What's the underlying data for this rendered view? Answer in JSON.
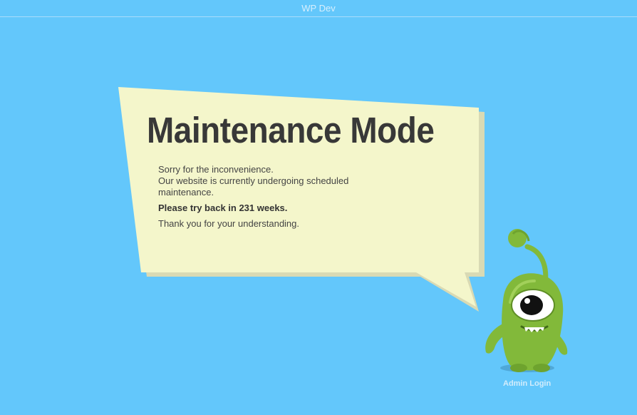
{
  "site": {
    "title": "WP Dev"
  },
  "maintenance": {
    "headline": "Maintenance Mode",
    "apology": "Sorry for the inconvenience.",
    "explanation": "Our website is currently undergoing scheduled maintenance.",
    "retry_notice": "Please try back in 231 weeks.",
    "thanks": "Thank you for your understanding."
  },
  "footer": {
    "admin_login_label": "Admin Login"
  },
  "colors": {
    "background": "#63c7fb",
    "bubble_fill": "#f4f6cb",
    "bubble_shadow": "#d9dab4",
    "headline_text": "#383838",
    "mascot_green": "#82b93a"
  },
  "icons": {
    "mascot": "one-eyed-green-alien-icon",
    "bubble": "speech-bubble"
  }
}
